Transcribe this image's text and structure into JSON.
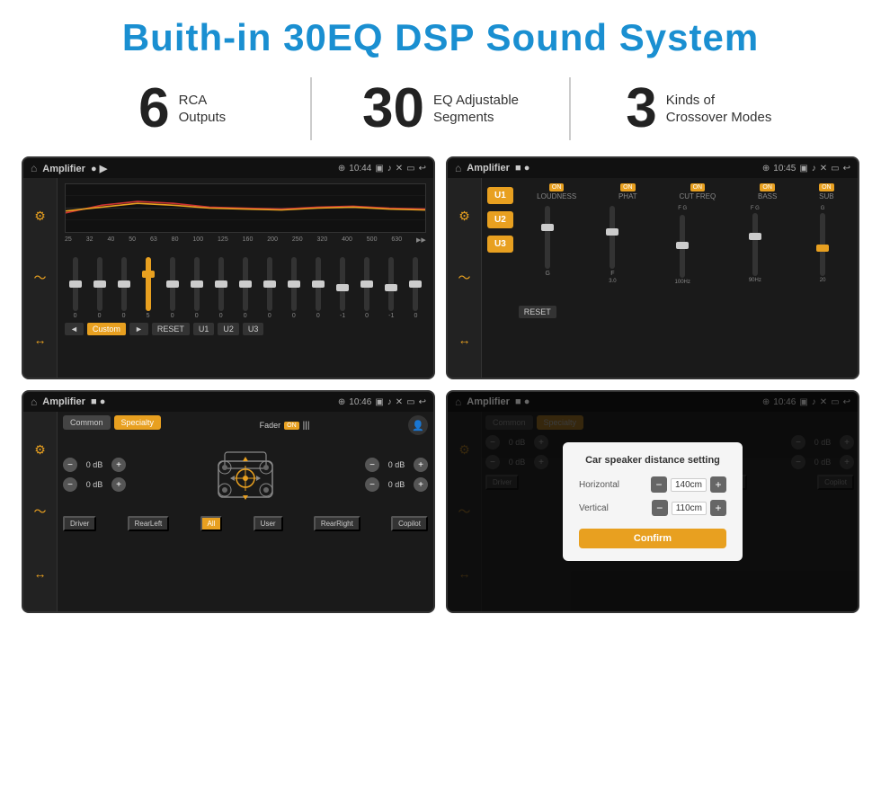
{
  "header": {
    "title": "Buith-in 30EQ DSP Sound System"
  },
  "stats": [
    {
      "number": "6",
      "label": "RCA\nOutputs"
    },
    {
      "number": "30",
      "label": "EQ Adjustable\nSegments"
    },
    {
      "number": "3",
      "label": "Kinds of\nCrossover Modes"
    }
  ],
  "screens": [
    {
      "id": "eq-screen",
      "statusTitle": "Amplifier",
      "time": "10:44",
      "type": "eq"
    },
    {
      "id": "crossover-screen",
      "statusTitle": "Amplifier",
      "time": "10:45",
      "type": "crossover"
    },
    {
      "id": "fader-screen",
      "statusTitle": "Amplifier",
      "time": "10:46",
      "type": "fader"
    },
    {
      "id": "dialog-screen",
      "statusTitle": "Amplifier",
      "time": "10:46",
      "type": "dialog"
    }
  ],
  "eq": {
    "freqs": [
      "25",
      "32",
      "40",
      "50",
      "63",
      "80",
      "100",
      "125",
      "160",
      "200",
      "250",
      "320",
      "400",
      "500",
      "630"
    ],
    "values": [
      "0",
      "0",
      "0",
      "5",
      "0",
      "0",
      "0",
      "0",
      "0",
      "0",
      "0",
      "-1",
      "0",
      "-1"
    ],
    "controls": [
      "◄",
      "Custom",
      "►",
      "RESET",
      "U1",
      "U2",
      "U3"
    ]
  },
  "crossover": {
    "uButtons": [
      "U1",
      "U2",
      "U3"
    ],
    "channels": [
      "LOUDNESS",
      "PHAT",
      "CUT FREQ",
      "BASS",
      "SUB"
    ],
    "resetLabel": "RESET"
  },
  "fader": {
    "tabs": [
      "Common",
      "Specialty"
    ],
    "faderLabel": "Fader",
    "onLabel": "ON",
    "volumes": [
      "0 dB",
      "0 dB",
      "0 dB",
      "0 dB"
    ],
    "buttons": [
      "Driver",
      "RearLeft",
      "All",
      "User",
      "RearRight",
      "Copilot"
    ]
  },
  "dialog": {
    "title": "Car speaker distance setting",
    "horizontal": {
      "label": "Horizontal",
      "value": "140cm"
    },
    "vertical": {
      "label": "Vertical",
      "value": "110cm"
    },
    "confirmLabel": "Confirm"
  }
}
